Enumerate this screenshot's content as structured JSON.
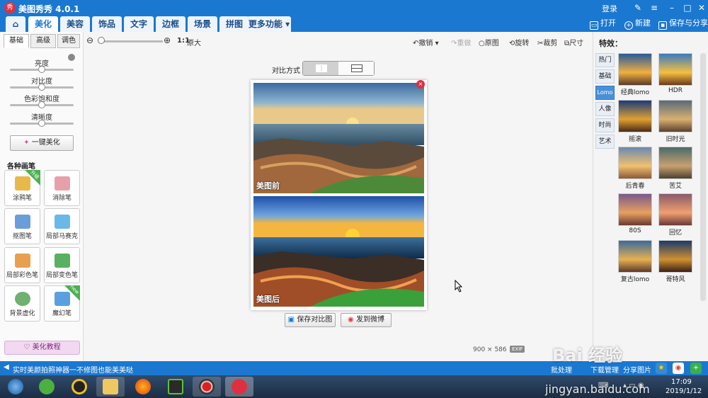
{
  "app": {
    "title": "美图秀秀 4.0.1",
    "logo": "秀",
    "login": "登录"
  },
  "tabs": [
    "美化",
    "美容",
    "饰品",
    "文字",
    "边框",
    "场景",
    "拼图",
    "更多功能"
  ],
  "menu_actions": {
    "open": "打开",
    "new": "新建",
    "save_share": "保存与分享"
  },
  "left": {
    "sub_tabs": [
      "基础",
      "高级",
      "调色"
    ],
    "sliders": [
      {
        "label": "亮度",
        "value": 0.5
      },
      {
        "label": "对比度",
        "value": 0.5
      },
      {
        "label": "色彩饱和度",
        "value": 0.5
      },
      {
        "label": "清晰度",
        "value": 0.5
      }
    ],
    "one_click": "一键美化",
    "brushes_title": "各种画笔",
    "brushes": [
      {
        "label": "涂鸦笔",
        "badge": "升级",
        "color": "#e8b84a"
      },
      {
        "label": "消除笔",
        "badge": "",
        "color": "#e8a0a8"
      },
      {
        "label": "抠图笔",
        "badge": "",
        "color": "#6a9ed8"
      },
      {
        "label": "局部马赛克",
        "badge": "",
        "color": "#6ab8e8"
      },
      {
        "label": "局部彩色笔",
        "badge": "",
        "color": "#e8a050"
      },
      {
        "label": "局部变色笔",
        "badge": "",
        "color": "#58b060"
      },
      {
        "label": "背景虚化",
        "badge": "",
        "color": "#70b070"
      },
      {
        "label": "魔幻笔",
        "badge": "new",
        "color": "#5aa0e0"
      }
    ],
    "tutorial": "美化教程"
  },
  "toolbar": {
    "zoom_1to1": "1:1",
    "original_size": "原大",
    "undo": "撤销",
    "redo": "重做",
    "original": "原图",
    "rotate": "旋转",
    "crop": "裁剪",
    "size": "尺寸"
  },
  "compare": {
    "label": "对比方式"
  },
  "photos": {
    "before": "美图前",
    "after": "美图后",
    "close": "×"
  },
  "actions": {
    "save_compare": "保存对比图",
    "send_weibo": "发到微博"
  },
  "image_info": {
    "size": "900 × 586",
    "exif": "EXIF"
  },
  "right": {
    "title": "特效：",
    "categories": [
      "热门",
      "基础",
      "Lomo",
      "人像",
      "时尚",
      "艺术"
    ],
    "active_category": 2,
    "effects": [
      "经典lomo",
      "HDR",
      "摇滚",
      "旧时光",
      "后青春",
      "苦艾",
      "80S",
      "回忆",
      "复古lomo",
      "哥特风"
    ]
  },
  "status": {
    "message": "实时美颜拍照神器一不修图也能美美哒",
    "batch": "批处理",
    "downloads": "下载管理",
    "share": "分享图片"
  },
  "taskbar": {
    "time": "17:09",
    "date": "2019/1/12"
  },
  "watermark": {
    "text": "Bai 经验",
    "url": "jingyan.baidu.com"
  }
}
